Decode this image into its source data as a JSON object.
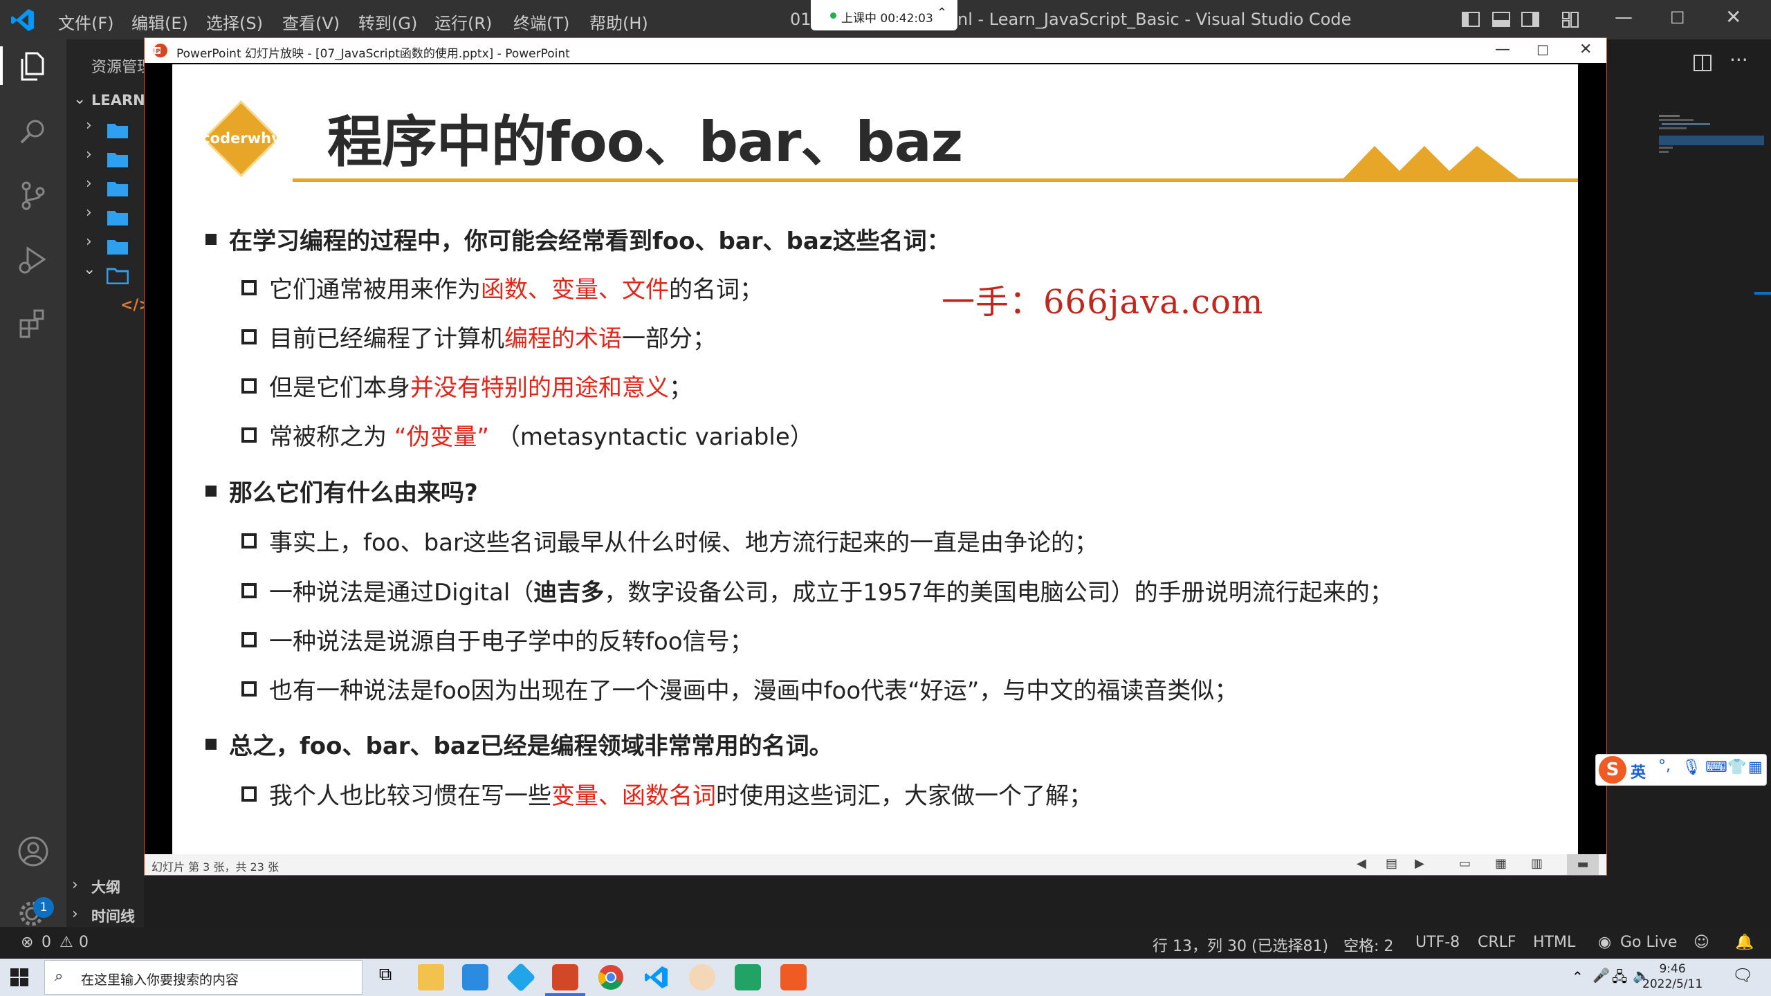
{
  "vscode": {
    "menu": [
      "文件(F)",
      "编辑(E)",
      "选择(S)",
      "查看(V)",
      "转到(G)",
      "运行(R)",
      "终端(T)",
      "帮助(H)"
    ],
    "title_prefix": "01",
    "title": "nl - Learn_JavaScript_Basic - Visual Studio Code",
    "explorer_title": "资源管理",
    "workspace": "LEARN_",
    "outline": "大纲",
    "timeline": "时间线",
    "settings_badge": "1",
    "status": {
      "errors": "0",
      "warnings": "0",
      "position": "行 13，列 30 (已选择81)",
      "spaces": "空格: 2",
      "encoding": "UTF-8",
      "eol": "CRLF",
      "language": "HTML",
      "golive": "Go Live"
    }
  },
  "recording": {
    "label": "上课中 00:42:03"
  },
  "powerpoint": {
    "title": "PowerPoint 幻灯片放映 - [07_JavaScript函数的使用.pptx] - PowerPoint",
    "status": "幻灯片 第 3 张，共 23 张"
  },
  "slide": {
    "badge": "coderwhy",
    "title": "程序中的foo、bar、baz",
    "watermark": "一手：666java.com",
    "s1": {
      "heading": "在学习编程的过程中，你可能会经常看到foo、bar、baz这些名词：",
      "b1": {
        "a": "它们通常被用来作为",
        "b": "函数、变量、文件",
        "c": "的名词；"
      },
      "b2": {
        "a": "目前已经编程了计算机",
        "b": "编程的术语",
        "c": "一部分；"
      },
      "b3": {
        "a": "但是它们本身",
        "b": "并没有特别的用途和意义",
        "c": "；"
      },
      "b4": {
        "a": "常被称之为 ",
        "b": "“伪变量”",
        "c": " （metasyntactic variable）"
      }
    },
    "s2": {
      "heading": "那么它们有什么由来吗?",
      "b1": "事实上，foo、bar这些名词最早从什么时候、地方流行起来的一直是由争论的；",
      "b2": {
        "a": "一种说法是通过Digital（",
        "b": "迪吉多",
        "c": "，数字设备公司，成立于1957年的美国电脑公司）的手册说明流行起来的；"
      },
      "b3": "一种说法是说源自于电子学中的反转foo信号；",
      "b4": "也有一种说法是foo因为出现在了一个漫画中，漫画中foo代表“好运”，与中文的福读音类似；"
    },
    "s3": {
      "heading": "总之，foo、bar、baz已经是编程领域非常常用的名词。",
      "b1": {
        "a": "我个人也比较习惯在写一些",
        "b": "变量",
        "c": "、",
        "d": "函数名词",
        "e": "时使用这些词汇，大家做一个了解；"
      }
    }
  },
  "ime": {
    "lang": "英"
  },
  "taskbar": {
    "search_placeholder": "在这里输入你要搜索的内容",
    "time": "9:46",
    "date": "2022/5/11"
  },
  "colors": {
    "accent_red": "#e0261b",
    "badge_gold": "#e7a628",
    "ppt_orange": "#d24726",
    "vscode_blue": "#0098ff"
  }
}
